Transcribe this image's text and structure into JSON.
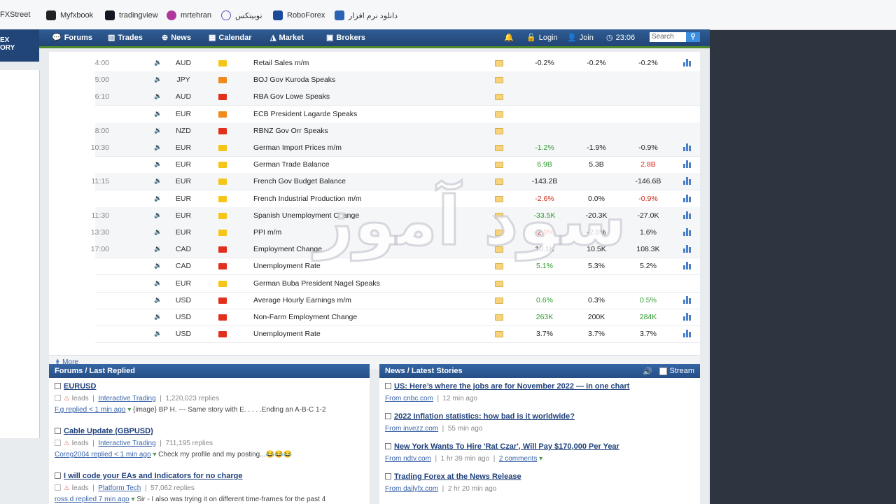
{
  "bookmarks": [
    {
      "label": "FXStreet",
      "x": 0
    },
    {
      "label": "Myfxbook"
    },
    {
      "label": "tradingview"
    },
    {
      "label": "mrtehran"
    },
    {
      "label": "نوبیتکس"
    },
    {
      "label": "RoboForex"
    },
    {
      "label": "دانلود نرم افزار"
    }
  ],
  "nav": {
    "logo_line1": "EX",
    "logo_line2": "ORY",
    "forums": "Forums",
    "trades": "Trades",
    "news": "News",
    "calendar": "Calendar",
    "market": "Market",
    "brokers": "Brokers",
    "login": "Login",
    "join": "Join",
    "time": "23:06",
    "search_placeholder": "Search"
  },
  "calendar": {
    "rows": [
      {
        "time": "4:00",
        "currency": "AUD",
        "impact": "yel",
        "event": "Retail Sales m/m",
        "actual": "-0.2%",
        "actual_color": "",
        "forecast": "-0.2%",
        "previous": "-0.2%",
        "chart": true
      },
      {
        "time": "5:00",
        "currency": "JPY",
        "impact": "ora",
        "event": "BOJ Gov Kuroda Speaks",
        "actual": "",
        "actual_color": "",
        "forecast": "",
        "previous": "",
        "chart": false
      },
      {
        "time": "6:10",
        "currency": "AUD",
        "impact": "red",
        "event": "RBA Gov Lowe Speaks",
        "actual": "",
        "actual_color": "",
        "forecast": "",
        "previous": "",
        "chart": false
      },
      {
        "time": "",
        "currency": "EUR",
        "impact": "ora",
        "event": "ECB President Lagarde Speaks",
        "actual": "",
        "actual_color": "",
        "forecast": "",
        "previous": "",
        "chart": false
      },
      {
        "time": "8:00",
        "currency": "NZD",
        "impact": "red",
        "event": "RBNZ Gov Orr Speaks",
        "actual": "",
        "actual_color": "",
        "forecast": "",
        "previous": "",
        "chart": false
      },
      {
        "time": "10:30",
        "currency": "EUR",
        "impact": "yel",
        "event": "German Import Prices m/m",
        "actual": "-1.2%",
        "actual_color": "green",
        "forecast": "-1.9%",
        "previous": "-0.9%",
        "chart": true
      },
      {
        "time": "",
        "currency": "EUR",
        "impact": "yel",
        "event": "German Trade Balance",
        "actual": "6.9B",
        "actual_color": "green",
        "forecast": "5.3B",
        "previous": "2.8B",
        "previous_color": "red",
        "chart": true
      },
      {
        "time": "11:15",
        "currency": "EUR",
        "impact": "yel",
        "event": "French Gov Budget Balance",
        "actual": "-143.2B",
        "actual_color": "",
        "forecast": "",
        "previous": "-146.6B",
        "chart": true
      },
      {
        "time": "",
        "currency": "EUR",
        "impact": "yel",
        "event": "French Industrial Production m/m",
        "actual": "-2.6%",
        "actual_color": "red",
        "forecast": "0.0%",
        "previous": "-0.9%",
        "previous_color": "red",
        "chart": true
      },
      {
        "time": "11:30",
        "currency": "EUR",
        "impact": "yel",
        "event": "Spanish Unemployment Change",
        "actual": "-33.5K",
        "actual_color": "green",
        "forecast": "-20.3K",
        "previous": "-27.0K",
        "chart": true
      },
      {
        "time": "13:30",
        "currency": "EUR",
        "impact": "yel",
        "event": "PPI m/m",
        "actual": "-2.9%",
        "actual_color": "red",
        "forecast": "-2.0%",
        "previous": "1.6%",
        "chart": true
      },
      {
        "time": "17:00",
        "currency": "CAD",
        "impact": "red",
        "event": "Employment Change",
        "actual": "10.1K",
        "actual_color": "",
        "forecast": "10.5K",
        "previous": "108.3K",
        "chart": true
      },
      {
        "time": "",
        "currency": "CAD",
        "impact": "red",
        "event": "Unemployment Rate",
        "actual": "5.1%",
        "actual_color": "green",
        "forecast": "5.3%",
        "previous": "5.2%",
        "chart": true
      },
      {
        "time": "",
        "currency": "EUR",
        "impact": "yel",
        "event": "German Buba President Nagel Speaks",
        "actual": "",
        "actual_color": "",
        "forecast": "",
        "previous": "",
        "chart": false
      },
      {
        "time": "",
        "currency": "USD",
        "impact": "red",
        "event": "Average Hourly Earnings m/m",
        "actual": "0.6%",
        "actual_color": "green",
        "forecast": "0.3%",
        "previous": "0.5%",
        "previous_color": "green",
        "chart": true
      },
      {
        "time": "",
        "currency": "USD",
        "impact": "red",
        "event": "Non-Farm Employment Change",
        "actual": "263K",
        "actual_color": "green",
        "forecast": "200K",
        "previous": "284K",
        "previous_color": "green",
        "chart": true
      },
      {
        "time": "",
        "currency": "USD",
        "impact": "red",
        "event": "Unemployment Rate",
        "actual": "3.7%",
        "actual_color": "",
        "forecast": "3.7%",
        "previous": "3.7%",
        "chart": true
      }
    ],
    "more_label": "More"
  },
  "forums": {
    "header": "Forums / Last Replied",
    "items": [
      {
        "title": "EURUSD",
        "author": "leads",
        "category": "Interactive Trading",
        "replies": "1,220,023 replies",
        "last": "F.g replied < 1 min ago",
        "snippet": "{image} BP H. --- Same story with E. . . . .Ending an A-B-C 1-2"
      },
      {
        "title": "Cable Update (GBPUSD)",
        "author": "leads",
        "category": "Interactive Trading",
        "replies": "711,195 replies",
        "last": "Coreg2004 replied < 1 min ago",
        "snippet": "Check my profile and my posting...😂😂😂"
      },
      {
        "title": "I will code your EAs and Indicators for no charge",
        "author": "leads",
        "category": "Platform Tech",
        "replies": "57,062 replies",
        "last": "ross.d replied 7 min ago",
        "snippet": "Sir - I also was trying it on different time-frames for the past 4"
      }
    ]
  },
  "news": {
    "header": "News / Latest Stories",
    "stream_label": "Stream",
    "items": [
      {
        "title": "US: Here’s where the jobs are for November 2022 — in one chart",
        "source": "From cnbc.com",
        "age": "12 min ago",
        "comments": ""
      },
      {
        "title": "2022 Inflation statistics: how bad is it worldwide?",
        "source": "From invezz.com",
        "age": "55 min ago",
        "comments": ""
      },
      {
        "title": "New York Wants To Hire 'Rat Czar', Will Pay $170,000 Per Year",
        "source": "From ndtv.com",
        "age": "1 hr 39 min ago",
        "comments": "2 comments"
      },
      {
        "title": "Trading Forex at the News Release",
        "source": "From dailyfx.com",
        "age": "2 hr 20 min ago",
        "comments": ""
      }
    ]
  },
  "watermark": "سود آموز"
}
